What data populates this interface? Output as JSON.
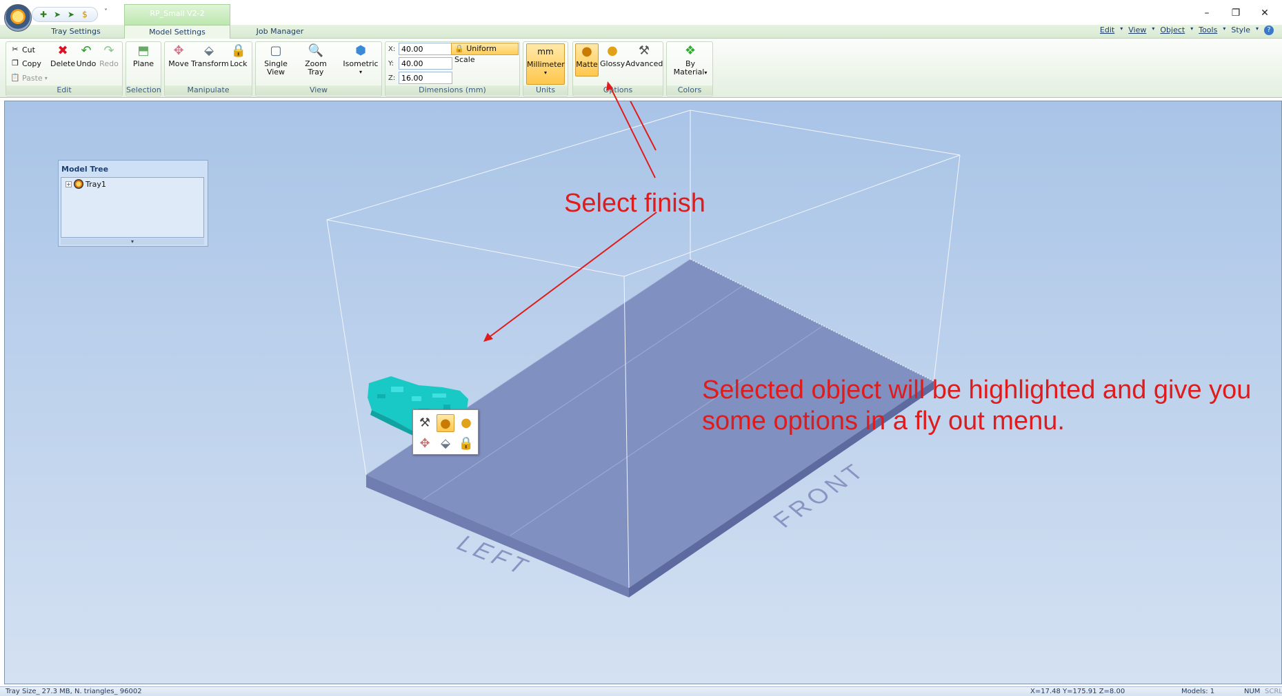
{
  "title_bar": {
    "document_tab": "RP_Small V2-2",
    "qat_more": "˅",
    "window_controls": {
      "minimize": "–",
      "restore": "❐",
      "close": "✕"
    }
  },
  "tabs": [
    {
      "label": "Tray Settings",
      "active": false
    },
    {
      "label": "Model Settings",
      "active": true
    },
    {
      "label": "Job Manager",
      "active": false
    }
  ],
  "right_menu": [
    "Edit",
    "View",
    "Object",
    "Tools",
    "Style"
  ],
  "ribbon": {
    "edit": {
      "label": "Edit",
      "cut": "Cut",
      "copy": "Copy",
      "paste": "Paste",
      "delete": "Delete",
      "undo": "Undo",
      "redo": "Redo"
    },
    "selection": {
      "label": "Selection",
      "plane": "Plane"
    },
    "manipulate": {
      "label": "Manipulate",
      "move": "Move",
      "transform": "Transform",
      "lock": "Lock"
    },
    "view": {
      "label": "View",
      "single_view": "Single\nView",
      "zoom_tray": "Zoom\nTray",
      "isometric": "Isometric"
    },
    "dimensions": {
      "label": "Dimensions (mm)",
      "x_label": "X:",
      "y_label": "Y:",
      "z_label": "Z:",
      "x": "40.00",
      "y": "40.00",
      "z": "16.00",
      "uniform_scale": "Uniform Scale"
    },
    "units": {
      "label": "Units",
      "mm": "mm",
      "millimeter": "Millimeter"
    },
    "options": {
      "label": "Options",
      "matte": "Matte",
      "glossy": "Glossy",
      "advanced": "Advanced"
    },
    "colors": {
      "label": "Colors",
      "by_material": "By\nMaterial"
    }
  },
  "model_tree": {
    "title": "Model Tree",
    "items": [
      "Tray1"
    ]
  },
  "tray_labels": {
    "left": "LEFT",
    "front": "FRONT"
  },
  "annotations": {
    "select_finish": "Select finish",
    "selected_object": "Selected object will be highlighted and give you some options in a fly out menu."
  },
  "status": {
    "tray_info": "Tray Size_ 27.3 MB, N. triangles_ 96002",
    "coords": "X=17.48 Y=175.91 Z=8.00",
    "models": "Models: 1",
    "num": "NUM",
    "scrl": "SCRL"
  },
  "colors": {
    "annotation_red": "#e01b1b",
    "viewport_bg": "#a8c4e6",
    "model_cyan": "#19c9c6",
    "tray_top": "#7f8fbd"
  }
}
